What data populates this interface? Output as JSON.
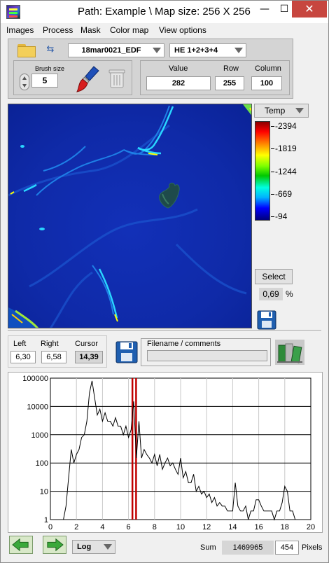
{
  "window": {
    "title": "Path: Example \\ Map size: 256 X 256",
    "minimize": "—",
    "maximize": "☐",
    "close": "✕"
  },
  "menu": [
    "Images",
    "Process",
    "Mask",
    "Color map",
    "View options"
  ],
  "toolbar": {
    "file_dropdown": "18mar0021_EDF",
    "he_dropdown": "HE 1+2+3+4",
    "brush_size_label": "Brush size",
    "brush_size_value": "5",
    "value_label": "Value",
    "row_label": "Row",
    "column_label": "Column",
    "value": "282",
    "row": "255",
    "column": "100"
  },
  "colormap": {
    "dropdown": "Temp",
    "labels": [
      "-2394",
      "-1819",
      "-1244",
      "-669",
      "-94"
    ],
    "select_button": "Select",
    "percent_value": "0,69",
    "percent_unit": "%"
  },
  "range": {
    "left_label": "Left",
    "right_label": "Right",
    "cursor_label": "Cursor",
    "left": "6,30",
    "right": "6,58",
    "cursor": "14,39",
    "filename_label": "Filename / comments",
    "filename_value": ""
  },
  "chart_data": {
    "type": "line",
    "yscale": "log",
    "xlim": [
      0,
      20
    ],
    "ylim": [
      1,
      100000
    ],
    "x_ticks": [
      "0",
      "2",
      "4",
      "6",
      "8",
      "10",
      "12",
      "14",
      "16",
      "18",
      "20"
    ],
    "y_ticks": [
      "100000",
      "10000",
      "1000",
      "100",
      "10",
      "1"
    ],
    "grid": true,
    "markers": [
      6.3,
      6.58
    ],
    "series": [
      {
        "x": [
          1.0,
          1.2,
          1.4,
          1.6,
          1.8,
          2.0,
          2.2,
          2.4,
          2.6,
          2.8,
          3.0,
          3.2,
          3.4,
          3.6,
          3.8,
          4.0,
          4.2,
          4.4,
          4.6,
          4.8,
          5.0,
          5.2,
          5.4,
          5.6,
          5.8,
          6.0,
          6.2,
          6.4,
          6.6,
          6.8,
          7.0,
          7.2,
          7.4,
          7.6,
          7.8,
          8.0,
          8.2,
          8.4,
          8.6,
          8.8,
          9.0,
          9.2,
          9.4,
          9.6,
          9.8,
          10.0,
          10.2,
          10.4,
          10.6,
          10.8,
          11.0,
          11.2,
          11.4,
          11.6,
          11.8,
          12.0,
          12.2,
          12.4,
          12.6,
          12.8,
          13.0,
          13.2,
          13.4,
          13.6,
          13.8,
          14.0,
          14.2,
          14.4,
          14.6,
          14.8,
          15.0,
          15.2,
          15.4,
          15.6,
          15.8,
          16.0,
          16.2,
          16.4,
          16.6,
          16.8,
          17.0,
          17.2,
          17.4,
          17.6,
          17.8,
          18.0,
          18.2,
          18.4,
          18.6,
          18.8,
          19.0,
          19.2,
          19.4,
          19.6,
          19.8
        ],
        "y": [
          1,
          3,
          30,
          300,
          100,
          200,
          300,
          800,
          1000,
          3000,
          30000,
          80000,
          20000,
          5000,
          8000,
          3000,
          6000,
          3000,
          3000,
          2000,
          4000,
          2000,
          2000,
          1000,
          2000,
          800,
          1500,
          15000,
          150,
          3000,
          150,
          300,
          200,
          150,
          100,
          200,
          80,
          200,
          60,
          100,
          150,
          80,
          100,
          60,
          40,
          150,
          30,
          50,
          20,
          20,
          40,
          10,
          15,
          8,
          10,
          6,
          8,
          4,
          6,
          3,
          4,
          3,
          3,
          2,
          2,
          2,
          20,
          3,
          2,
          2,
          3,
          1,
          2,
          2,
          5,
          5,
          3,
          2,
          2,
          2,
          2,
          1,
          2,
          2,
          4,
          15,
          10,
          2,
          2,
          1,
          1,
          1,
          1,
          1,
          1
        ]
      }
    ]
  },
  "bottom": {
    "scale_dropdown": "Log",
    "sum_label": "Sum",
    "sum_value": "1469965",
    "pixels_value": "454",
    "pixels_label": "Pixels"
  }
}
